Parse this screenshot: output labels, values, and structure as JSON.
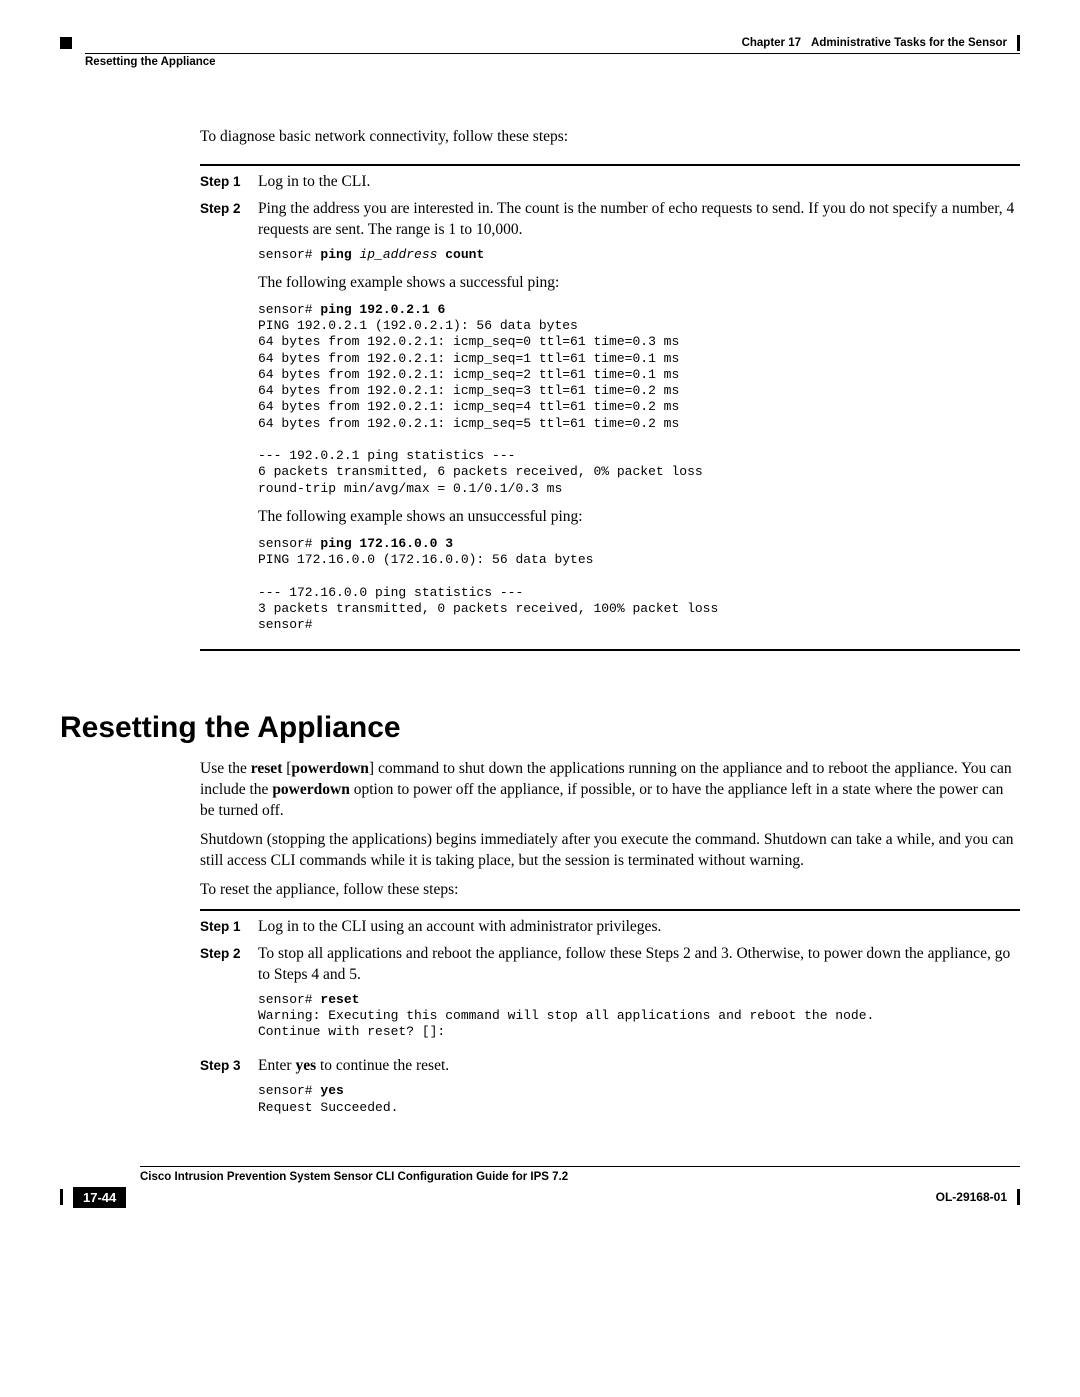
{
  "header": {
    "chapter": "Chapter 17",
    "title": "Administrative Tasks for the Sensor",
    "section": "Resetting the Appliance"
  },
  "sec1": {
    "intro": "To diagnose basic network connectivity, follow these steps:",
    "step1_label": "Step 1",
    "step1_text": "Log in to the CLI.",
    "step2_label": "Step 2",
    "step2_text": "Ping the address you are interested in. The count is the number of echo requests to send. If you do not specify a number, 4 requests are sent. The range is 1 to 10,000.",
    "code1_prefix": "sensor# ",
    "code1_cmd": "ping ",
    "code1_arg": "ip_address",
    "code1_suffix": " count",
    "para2": "The following example shows a successful ping:",
    "code2_line1_prefix": "sensor# ",
    "code2_line1_cmd": "ping 192.0.2.1 6",
    "code2_body": "PING 192.0.2.1 (192.0.2.1): 56 data bytes\n64 bytes from 192.0.2.1: icmp_seq=0 ttl=61 time=0.3 ms\n64 bytes from 192.0.2.1: icmp_seq=1 ttl=61 time=0.1 ms\n64 bytes from 192.0.2.1: icmp_seq=2 ttl=61 time=0.1 ms\n64 bytes from 192.0.2.1: icmp_seq=3 ttl=61 time=0.2 ms\n64 bytes from 192.0.2.1: icmp_seq=4 ttl=61 time=0.2 ms\n64 bytes from 192.0.2.1: icmp_seq=5 ttl=61 time=0.2 ms\n\n--- 192.0.2.1 ping statistics ---\n6 packets transmitted, 6 packets received, 0% packet loss\nround-trip min/avg/max = 0.1/0.1/0.3 ms",
    "para3": "The following example shows an unsuccessful ping:",
    "code3_line1_prefix": "sensor# ",
    "code3_line1_cmd": "ping 172.16.0.0 3",
    "code3_body": "PING 172.16.0.0 (172.16.0.0): 56 data bytes\n\n--- 172.16.0.0 ping statistics ---\n3 packets transmitted, 0 packets received, 100% packet loss\nsensor#"
  },
  "sec2": {
    "heading": "Resetting the Appliance",
    "p1_a": "Use the ",
    "p1_b": "reset",
    "p1_c": " [",
    "p1_d": "powerdown",
    "p1_e": "] command to shut down the applications running on the appliance and to reboot the appliance. You can include the ",
    "p1_f": "powerdown",
    "p1_g": " option to power off the appliance, if possible, or to have the appliance left in a state where the power can be turned off.",
    "p2": "Shutdown (stopping the applications) begins immediately after you execute the command. Shutdown can take a while, and you can still access CLI commands while it is taking place, but the session is terminated without warning.",
    "p3": "To reset the appliance, follow these steps:",
    "step1_label": "Step 1",
    "step1_text": "Log in to the CLI using an account with administrator privileges.",
    "step2_label": "Step 2",
    "step2_text": "To stop all applications and reboot the appliance, follow these Steps 2 and 3. Otherwise, to power down the appliance, go to Steps 4 and 5.",
    "code1_prefix": "sensor# ",
    "code1_cmd": "reset",
    "code1_body": "Warning: Executing this command will stop all applications and reboot the node.\nContinue with reset? []:",
    "step3_label": "Step 3",
    "step3_a": "Enter ",
    "step3_b": "yes",
    "step3_c": " to continue the reset.",
    "code2_prefix": "sensor# ",
    "code2_cmd": "yes",
    "code2_body": "Request Succeeded."
  },
  "footer": {
    "guide": "Cisco Intrusion Prevention System Sensor CLI Configuration Guide for IPS 7.2",
    "page": "17-44",
    "docid": "OL-29168-01"
  }
}
